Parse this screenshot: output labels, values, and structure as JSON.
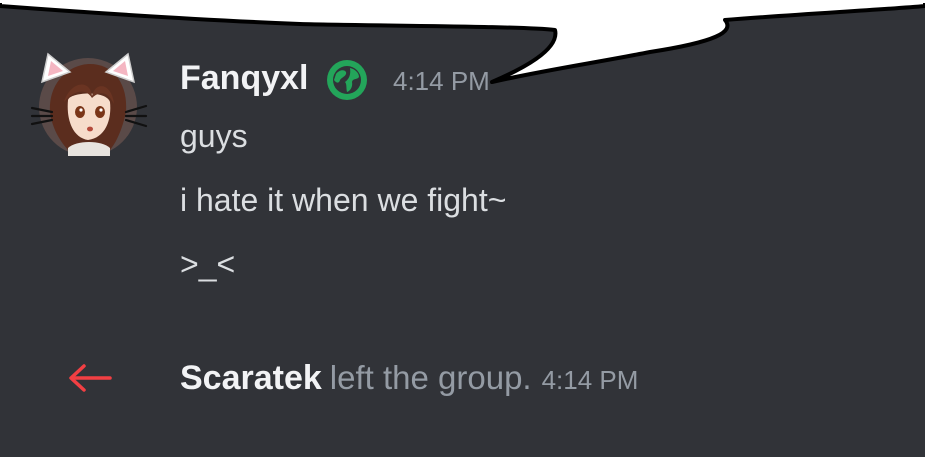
{
  "message": {
    "username": "Fanqyxl",
    "badge_icon": "globe-icon",
    "timestamp": "4:14 PM",
    "lines": [
      "guys",
      "i hate it when we fight~",
      ">_<"
    ]
  },
  "system_message": {
    "icon": "left-arrow-icon",
    "user": "Scaratek",
    "action": "left the group.",
    "timestamp": "4:14 PM"
  },
  "colors": {
    "background": "#313338",
    "username": "#f2f3f5",
    "message_text": "#dbdee1",
    "muted_text": "#949ba4",
    "badge_green": "#23a55a",
    "leave_red": "#f23f43"
  }
}
